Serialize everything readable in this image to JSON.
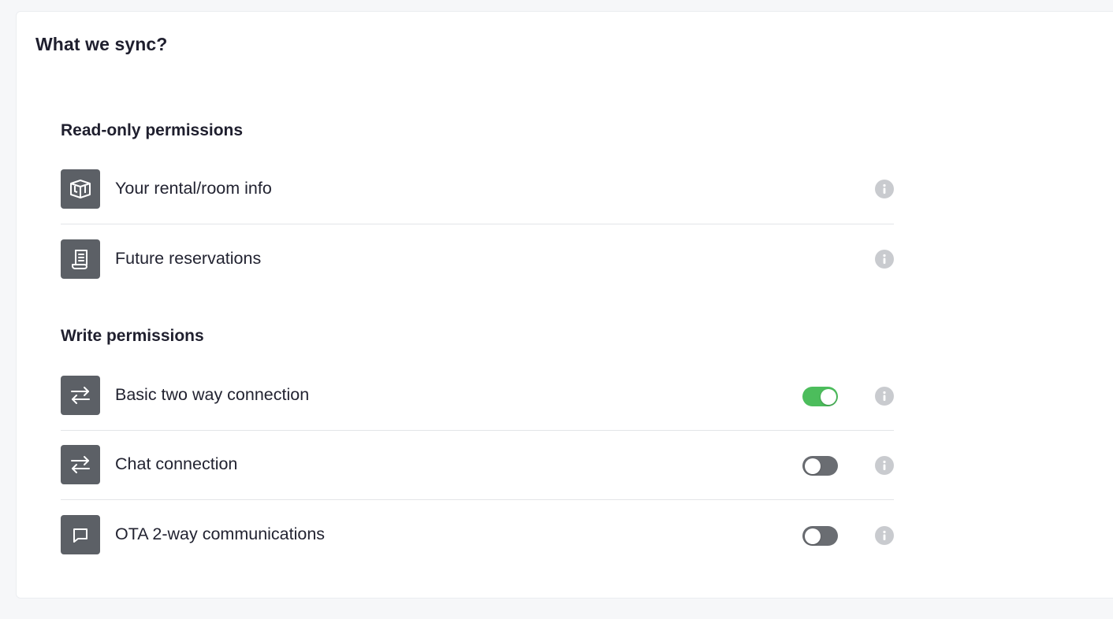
{
  "card": {
    "title": "What we sync?"
  },
  "read_only": {
    "title": "Read-only permissions",
    "items": [
      {
        "label": "Your rental/room info",
        "icon": "floor-plan-icon"
      },
      {
        "label": "Future reservations",
        "icon": "receipt-icon"
      }
    ]
  },
  "write": {
    "title": "Write permissions",
    "items": [
      {
        "label": "Basic two way connection",
        "icon": "sync-arrows-icon",
        "enabled": true
      },
      {
        "label": "Chat connection",
        "icon": "sync-arrows-icon",
        "enabled": false
      },
      {
        "label": "OTA 2-way communications",
        "icon": "chat-bubble-icon",
        "enabled": false
      }
    ]
  },
  "colors": {
    "icon_tile": "#5c6066",
    "toggle_on": "#4cbd5c",
    "toggle_off": "#6a6d72",
    "info_icon": "#c9cbcf"
  }
}
